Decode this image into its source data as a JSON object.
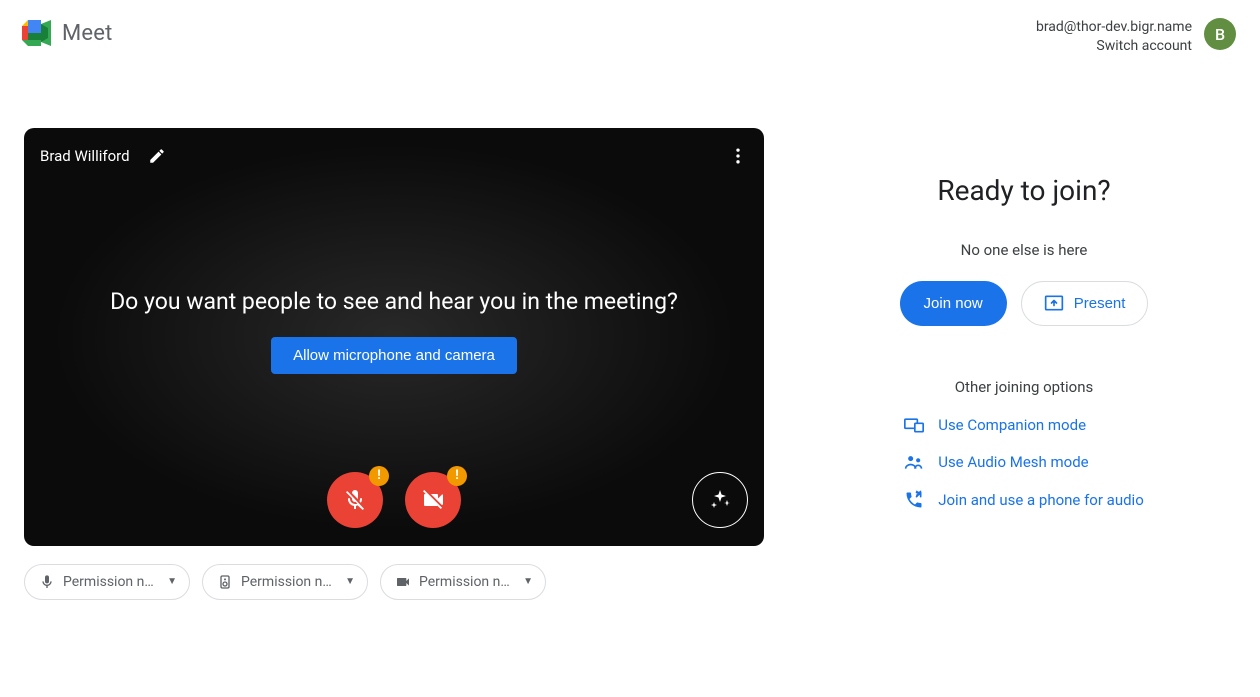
{
  "brand": {
    "name": "Meet"
  },
  "account": {
    "email": "brad@thor-dev.bigr.name",
    "switch_label": "Switch account",
    "avatar_initial": "B"
  },
  "preview": {
    "participant_name": "Brad Williford",
    "prompt": "Do you want people to see and hear you in the meeting?",
    "allow_label": "Allow microphone and camera"
  },
  "pills": {
    "mic": "Permission ne…",
    "speaker": "Permission ne…",
    "cam": "Permission ne…"
  },
  "join": {
    "headline": "Ready to join?",
    "subtext": "No one else is here",
    "join_label": "Join now",
    "present_label": "Present",
    "other_header": "Other joining options",
    "options": {
      "companion": "Use Companion mode",
      "audiomesh": "Use Audio Mesh mode",
      "phone": "Join and use a phone for audio"
    }
  }
}
